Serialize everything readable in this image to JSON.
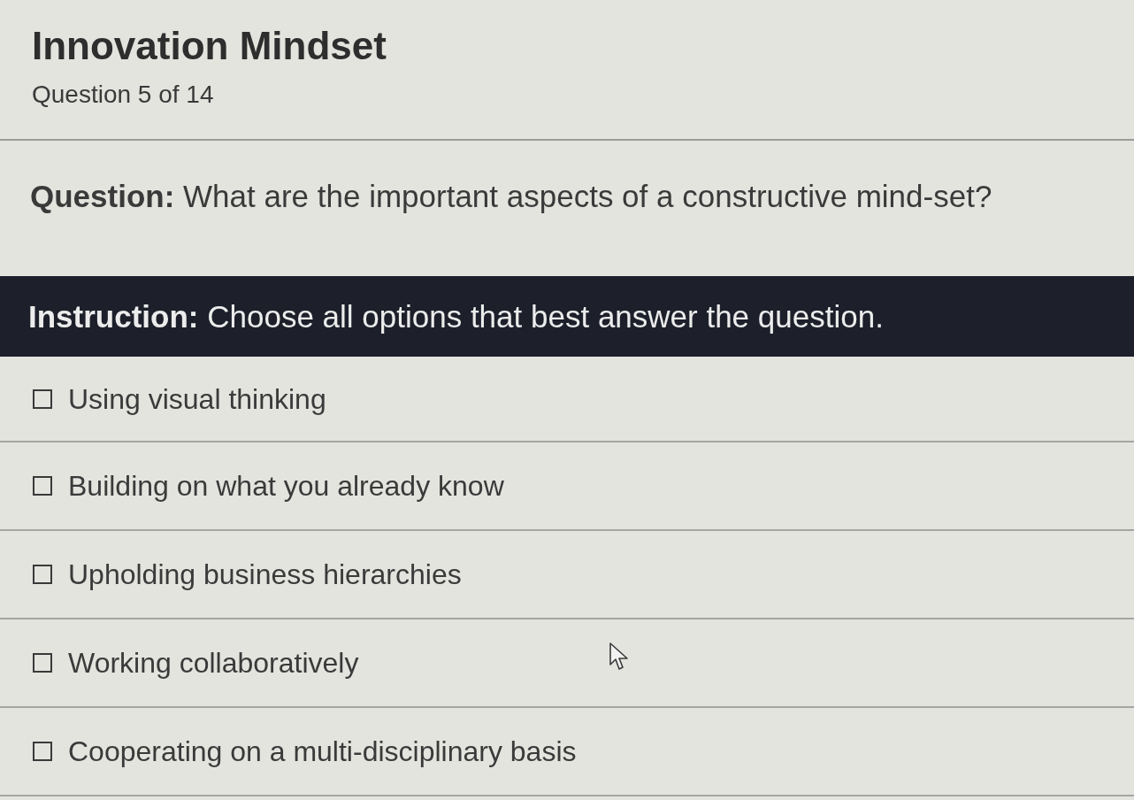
{
  "header": {
    "title": "Innovation Mindset",
    "progress": "Question 5 of 14"
  },
  "question": "**Question:** What are the important aspects of a constructive mind-set?",
  "instruction": "**Instruction:** Choose all options that best answer the question.",
  "options": [
    {
      "label": "Using visual thinking",
      "checked": false
    },
    {
      "label": "Building on what you already know",
      "checked": false
    },
    {
      "label": "Upholding business hierarchies",
      "checked": false
    },
    {
      "label": "Working collaboratively",
      "checked": false
    },
    {
      "label": "Cooperating on a multi-disciplinary basis",
      "checked": false
    }
  ]
}
